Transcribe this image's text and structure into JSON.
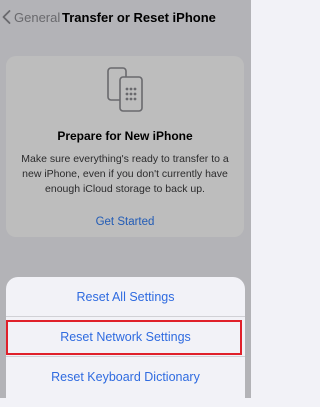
{
  "nav": {
    "back_label": "General",
    "title": "Transfer or Reset iPhone"
  },
  "prepare_card": {
    "title": "Prepare for New iPhone",
    "description": "Make sure everything's ready to transfer to a new iPhone, even if you don't currently have enough iCloud storage to back up.",
    "action_label": "Get Started",
    "icon": "phone-transfer-icon"
  },
  "action_sheet": {
    "options": [
      {
        "label": "Reset All Settings"
      },
      {
        "label": "Reset Network Settings",
        "highlighted": true
      },
      {
        "label": "Reset Keyboard Dictionary"
      }
    ]
  },
  "colors": {
    "accent": "#2f7cf6",
    "highlight": "#e0202a",
    "background": "#f2f2f7"
  }
}
